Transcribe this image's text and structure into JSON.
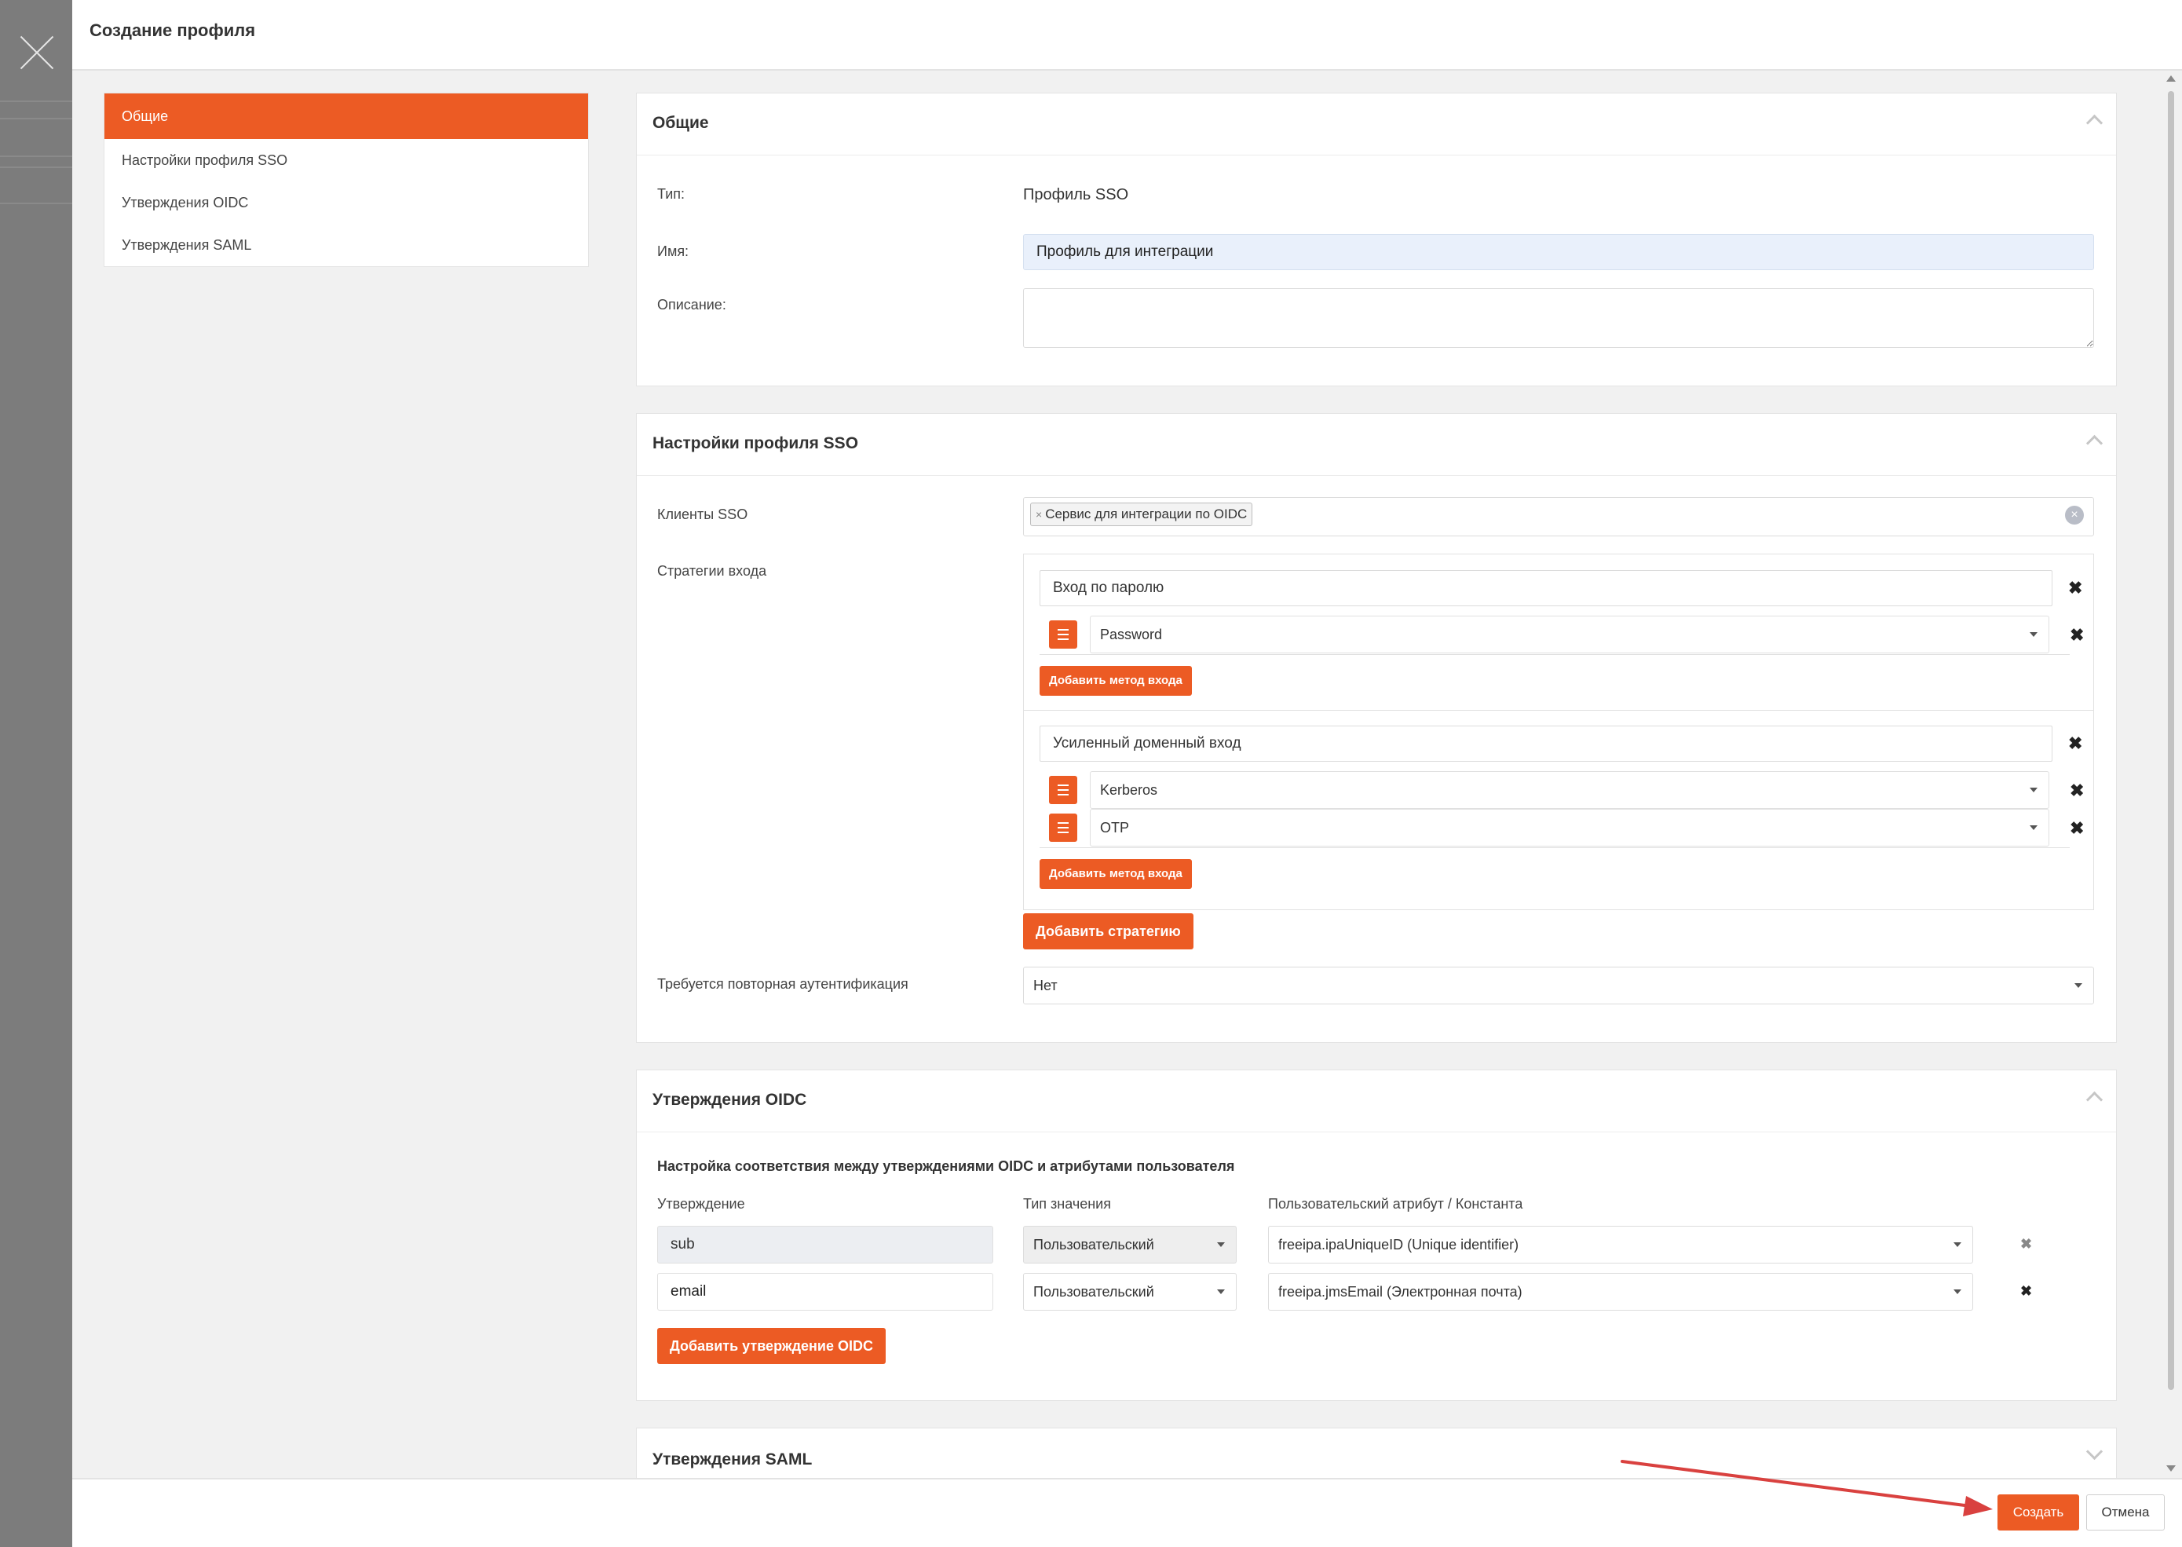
{
  "modal": {
    "title": "Создание профиля"
  },
  "sidebar": {
    "items": [
      {
        "label": "Общие"
      },
      {
        "label": "Настройки профиля SSO"
      },
      {
        "label": "Утверждения OIDC"
      },
      {
        "label": "Утверждения SAML"
      }
    ]
  },
  "general": {
    "title": "Общие",
    "type_label": "Тип:",
    "type_value": "Профиль SSO",
    "name_label": "Имя:",
    "name_value": "Профиль для интеграции",
    "description_label": "Описание:",
    "description_value": ""
  },
  "sso": {
    "title": "Настройки профиля SSO",
    "clients_label": "Клиенты SSO",
    "client_tag": "Сервис для интеграции по OIDC",
    "strategies_label": "Стратегии входа",
    "strategies": [
      {
        "name": "Вход по паролю",
        "methods": [
          "Password"
        ]
      },
      {
        "name": "Усиленный доменный вход",
        "methods": [
          "Kerberos",
          "OTP"
        ]
      }
    ],
    "add_method_label": "Добавить метод входа",
    "add_strategy_label": "Добавить стратегию",
    "reauth_label": "Требуется повторная аутентификация",
    "reauth_value": "Нет"
  },
  "oidc": {
    "title": "Утверждения OIDC",
    "subtitle": "Настройка соответствия между утверждениями OIDC и атрибутами пользователя",
    "col_claim": "Утверждение",
    "col_type": "Тип значения",
    "col_attr": "Пользовательский атрибут / Константа",
    "rows": [
      {
        "claim": "sub",
        "type": "Пользовательский",
        "attr": "freeipa.ipaUniqueID (Unique identifier)"
      },
      {
        "claim": "email",
        "type": "Пользовательский",
        "attr": "freeipa.jmsEmail (Электронная почта)"
      }
    ],
    "add_label": "Добавить утверждение OIDC"
  },
  "saml": {
    "title": "Утверждения SAML"
  },
  "footer": {
    "create_label": "Создать",
    "cancel_label": "Отмена"
  },
  "colors": {
    "accent": "#ec5b24",
    "annotation_arrow": "#d9413f"
  }
}
